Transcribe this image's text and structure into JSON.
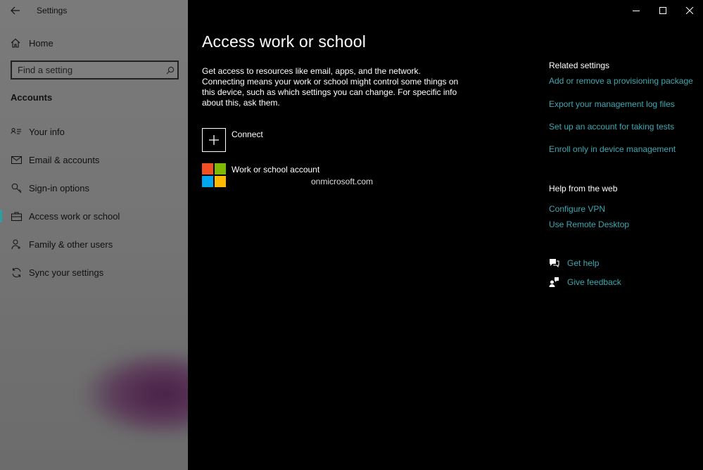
{
  "app": {
    "title": "Settings"
  },
  "sidebar": {
    "home_label": "Home",
    "search_placeholder": "Find a setting",
    "section_label": "Accounts",
    "items": [
      {
        "label": "Your info",
        "icon": "contact-card-icon"
      },
      {
        "label": "Email & accounts",
        "icon": "mail-icon"
      },
      {
        "label": "Sign-in options",
        "icon": "key-icon"
      },
      {
        "label": "Access work or school",
        "icon": "briefcase-icon",
        "active": true
      },
      {
        "label": "Family & other users",
        "icon": "person-add-icon"
      },
      {
        "label": "Sync your settings",
        "icon": "sync-icon"
      }
    ]
  },
  "main": {
    "title": "Access work or school",
    "description": "Get access to resources like email, apps, and the network. Connecting means your work or school might control some things on this device, such as which settings you can change. For specific info about this, ask them.",
    "connect_label": "Connect",
    "account": {
      "title": "Work or school account",
      "subtitle": "onmicrosoft.com",
      "logo_colors": [
        "#f25022",
        "#7fba00",
        "#00a4ef",
        "#ffb900"
      ]
    }
  },
  "related": {
    "heading": "Related settings",
    "links": [
      "Add or remove a provisioning package",
      "Export your management log files",
      "Set up an account for taking tests",
      "Enroll only in device management"
    ]
  },
  "help_web": {
    "heading": "Help from the web",
    "links": [
      "Configure VPN",
      "Use Remote Desktop"
    ]
  },
  "support": {
    "get_help": "Get help",
    "give_feedback": "Give feedback"
  },
  "colors": {
    "accent": "#3aa9b0",
    "active_indicator": "#2aa0a6"
  }
}
